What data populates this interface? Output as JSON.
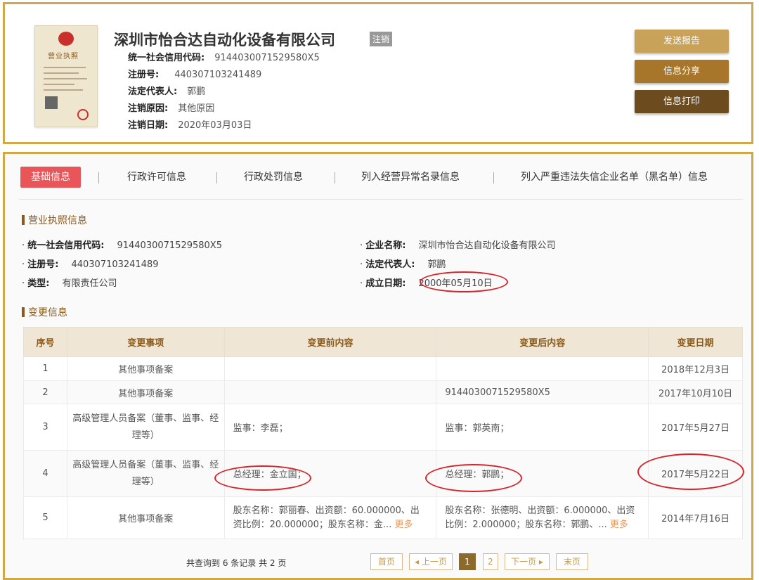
{
  "company": {
    "name": "深圳市怡合达自动化设备有限公司",
    "status": "注销",
    "rows": [
      {
        "label": "统一社会信用代码:",
        "value": "9144030071529580X5"
      },
      {
        "label": "注册号:",
        "value": "440307103241489"
      },
      {
        "label": "法定代表人:",
        "value": "郭鹏"
      },
      {
        "label": "注销原因:",
        "value": "其他原因"
      },
      {
        "label": "注销日期:",
        "value": "2020年03月03日"
      }
    ],
    "license_image": {
      "title": "营业执照"
    }
  },
  "actions": {
    "send_report": "发送报告",
    "share": "信息分享",
    "print": "信息打印",
    "colors": [
      "#c9a25a",
      "#a7762a",
      "#6c4c1e"
    ]
  },
  "tabs": [
    "基础信息",
    "行政许可信息",
    "行政处罚信息",
    "列入经营异常名录信息",
    "列入严重违法失信企业名单（黑名单）信息"
  ],
  "license_section": {
    "title": "营业执照信息",
    "fields": [
      {
        "label": "统一社会信用代码:",
        "value": "9144030071529580X5"
      },
      {
        "label": "企业名称:",
        "value": "深圳市怡合达自动化设备有限公司"
      },
      {
        "label": "注册号:",
        "value": "440307103241489"
      },
      {
        "label": "法定代表人:",
        "value": "郭鹏"
      },
      {
        "label": "类型:",
        "value": "有限责任公司"
      },
      {
        "label": "成立日期:",
        "value": "2000年05月10日"
      }
    ]
  },
  "change_section": {
    "title": "变更信息",
    "headers": [
      "序号",
      "变更事项",
      "变更前内容",
      "变更后内容",
      "变更日期"
    ],
    "rows": [
      {
        "no": "1",
        "item": "其他事项备案",
        "before": "",
        "after": "",
        "date": "2018年12月3日"
      },
      {
        "no": "2",
        "item": "其他事项备案",
        "before": "",
        "after": "9144030071529580X5",
        "date": "2017年10月10日"
      },
      {
        "no": "3",
        "item": "高级管理人员备案（董事、监事、经理等）",
        "before": "监事：李磊；",
        "after": "监事：郭英南；",
        "date": "2017年5月27日"
      },
      {
        "no": "4",
        "item": "高级管理人员备案（董事、监事、经理等）",
        "before": "总经理：金立国；",
        "after": "总经理：郭鹏；",
        "date": "2017年5月22日"
      },
      {
        "no": "5",
        "item": "其他事项备案",
        "before": "股东名称：郭丽春、出资额：60.000000、出资比例：20.000000；股东名称：金...",
        "before_more": "更多",
        "after": "股东名称：张德明、出资额：6.000000、出资比例：2.000000；股东名称：郭鹏、...",
        "after_more": "更多",
        "date": "2014年7月16日"
      }
    ]
  },
  "pager": {
    "summary": "共查询到 6 条记录 共 2 页",
    "first": "首页",
    "prev": "◂ 上一页",
    "pages": [
      "1",
      "2"
    ],
    "next": "下一页 ▸",
    "last": "末页"
  }
}
